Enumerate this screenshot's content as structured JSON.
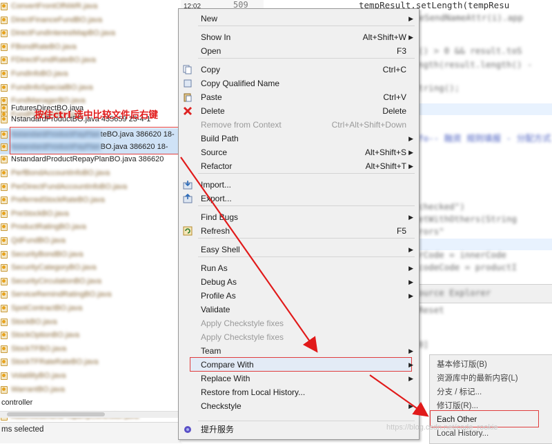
{
  "tree": {
    "rows_top": [
      "ConvertFrontOfNWR.java",
      "DirectFinanceFundBO.java",
      "DirectFundInterestMapBO.java",
      "FBondRateBO.java",
      "FDirectFundRateBO.java",
      "FundInfoBO.java",
      "FundInfoSpecialBO.java",
      "FundManagerBO.java",
      "FundPositionBO.java"
    ],
    "futures_label": "FuturesDirectBO.java",
    "nstandard_label": "NstandardProductBO.java 435659 23-4-1",
    "selected_1": {
      "hidden": "NstandardProductPayPlan",
      "visible": "teBO.java 386620  18-"
    },
    "selected_2": {
      "hidden": "NstandardProductPayPlan",
      "visible": "BO.java 386620  18-"
    },
    "row_after": "NstandardProductRepayPlanBO.java 386620",
    "rows_bottom": [
      "PerfBondAccountInfoBO.java",
      "PerDirectFundAccountInfoBO.java",
      "PreferredStockRateBO.java",
      "PreStockBO.java",
      "ProductRatingBO.java",
      "QdFundBO.java",
      "SecurityBondBO.java",
      "SecurityCategoryBO.java",
      "SecurityCirculationBO.java",
      "ServiceRemindRatingBO.java",
      "SpotContractBO.java",
      "StockBO.java",
      "StockOptionBO.java",
      "StockTFBO.java",
      "StockTFRateRateBO.java",
      "VolatilityBO.java",
      "WarrantBO.java"
    ],
    "controller_label": "controller",
    "last_row": "AddInvestmentPropertyController.java"
  },
  "status": {
    "text": "ms selected"
  },
  "editor": {
    "clock": "12:02",
    "line_number": "509",
    "code_top": "tempResult.setLength(tempResu"
  },
  "annotation": {
    "text": "按住ctrl  选中比较文件后右键"
  },
  "menu": {
    "items": [
      {
        "label": "New",
        "shortcut": "",
        "arrow": true
      },
      {
        "label": "Show In",
        "shortcut": "Alt+Shift+W",
        "arrow": true
      },
      {
        "label": "Open",
        "shortcut": "F3"
      },
      {
        "label": "Copy",
        "shortcut": "Ctrl+C"
      },
      {
        "label": "Copy Qualified Name",
        "shortcut": ""
      },
      {
        "label": "Paste",
        "shortcut": "Ctrl+V"
      },
      {
        "label": "Delete",
        "shortcut": "Delete"
      },
      {
        "label": "Remove from Context",
        "shortcut": "Ctrl+Alt+Shift+Down"
      },
      {
        "label": "Build Path",
        "shortcut": "",
        "arrow": true
      },
      {
        "label": "Source",
        "shortcut": "Alt+Shift+S",
        "arrow": true
      },
      {
        "label": "Refactor",
        "shortcut": "Alt+Shift+T",
        "arrow": true
      },
      {
        "label": "Import...",
        "shortcut": ""
      },
      {
        "label": "Export...",
        "shortcut": ""
      },
      {
        "label": "Find Bugs",
        "shortcut": "",
        "arrow": true
      },
      {
        "label": "Refresh",
        "shortcut": "F5"
      },
      {
        "label": "Easy Shell",
        "shortcut": "",
        "arrow": true
      },
      {
        "label": "Run As",
        "shortcut": "",
        "arrow": true
      },
      {
        "label": "Debug As",
        "shortcut": "",
        "arrow": true
      },
      {
        "label": "Profile As",
        "shortcut": "",
        "arrow": true
      },
      {
        "label": "Validate",
        "shortcut": ""
      },
      {
        "label": "Apply Checkstyle fixes",
        "shortcut": ""
      },
      {
        "label": "Apply Checkstyle fixes",
        "shortcut": ""
      },
      {
        "label": "Team",
        "shortcut": "",
        "arrow": true
      },
      {
        "label": "Compare With",
        "shortcut": "",
        "arrow": true
      },
      {
        "label": "Replace With",
        "shortcut": "",
        "arrow": true
      },
      {
        "label": "Restore from Local History...",
        "shortcut": ""
      },
      {
        "label": "Checkstyle",
        "shortcut": "",
        "arrow": true
      },
      {
        "label": "提升服务",
        "shortcut": ""
      }
    ]
  },
  "submenu": {
    "items": [
      "基本修订版(B)",
      "资源库中的最新内容(L)",
      "分支 / 标记...",
      "修订版(R)...",
      "Each Other",
      "Local History..."
    ]
  },
  "watermark": "https://blog.csdn.net/code_rookie",
  "colors": {
    "annotation_red": "#e11a1a",
    "selection_blue": "#cfe2f6",
    "menu_bg": "#f0f0f0"
  }
}
